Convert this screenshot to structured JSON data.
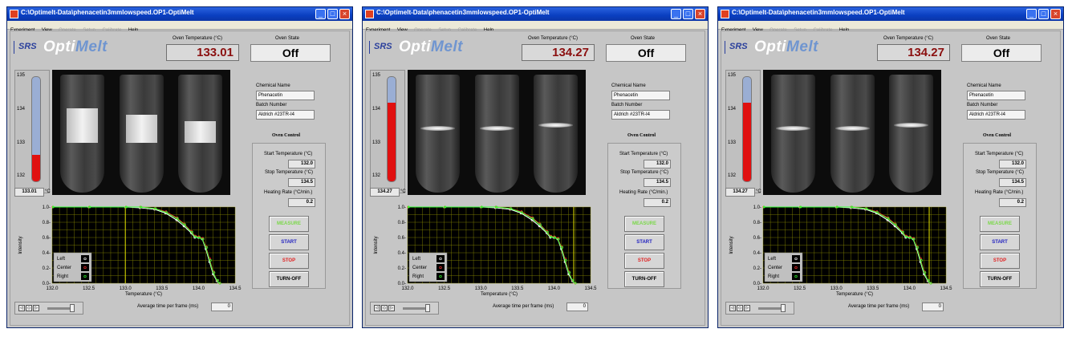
{
  "colors": {
    "titlebar": "#0a3fc0",
    "red_fill": "#e01010",
    "temp_text": "#8b1010",
    "plot_bg": "#000000",
    "grid": "#8f8f00",
    "vline": "#e6e600"
  },
  "windows": [
    {
      "title": "C:\\Optimelt-Data\\phenacetin3mmlowspeed.OP1-OptiMelt",
      "menu": [
        "Experiment",
        "View",
        "Operate",
        "Setup",
        "Calibrate",
        "Help"
      ],
      "logo": {
        "brand": "SRS",
        "opti": "Opti",
        "melt": "Melt"
      },
      "oven_temp_label": "Oven Temperature (°C)",
      "oven_temp": "133.01",
      "oven_state_label": "Oven State",
      "oven_state": "Off",
      "thermo_ticks": [
        "135",
        "134",
        "133",
        "132"
      ],
      "thermo_level": 0.252,
      "thermo_readout": "133.01",
      "thermo_unit": "°C",
      "frames": "powder",
      "chemical_name_label": "Chemical Name",
      "chemical_name": "Phenacetin",
      "batch_number_label": "Batch Number",
      "batch_number": "Aldrich #23TR-I4",
      "oven_control_title": "Oven Control",
      "start_temp_label": "Start Temperature (°C)",
      "start_temp": "132.0",
      "stop_temp_label": "Stop Temperature (°C)",
      "stop_temp": "134.5",
      "heating_rate_label": "Heating Rate (°C/min.)",
      "heating_rate": "0.2",
      "buttons": [
        "MEASURE",
        "START",
        "STOP",
        "TURN-OFF"
      ],
      "avg_label": "Average time per frame (ms)",
      "avg_value": "0",
      "legend": [
        "Left",
        "Center",
        "Right"
      ]
    },
    {
      "title": "C:\\Optimelt-Data\\phenacetin3mmlowspeed.OP1-OptiMelt",
      "menu": [
        "Experiment",
        "View",
        "Operate",
        "Setup",
        "Calibrate",
        "Help"
      ],
      "logo": {
        "brand": "SRS",
        "opti": "Opti",
        "melt": "Melt"
      },
      "oven_temp_label": "Oven Temperature (°C)",
      "oven_temp": "134.27",
      "oven_state_label": "Oven State",
      "oven_state": "Off",
      "thermo_ticks": [
        "135",
        "134",
        "133",
        "132"
      ],
      "thermo_level": 0.756,
      "thermo_readout": "134.27",
      "thermo_unit": "°C",
      "frames": "melted",
      "chemical_name_label": "Chemical Name",
      "chemical_name": "Phenacetin",
      "batch_number_label": "Batch Number",
      "batch_number": "Aldrich #23TR-I4",
      "oven_control_title": "Oven Control",
      "start_temp_label": "Start Temperature (°C)",
      "start_temp": "132.0",
      "stop_temp_label": "Stop Temperature (°C)",
      "stop_temp": "134.5",
      "heating_rate_label": "Heating Rate (°C/min.)",
      "heating_rate": "0.2",
      "buttons": [
        "MEASURE",
        "START",
        "STOP",
        "TURN-OFF"
      ],
      "avg_label": "Average time per frame (ms)",
      "avg_value": "0",
      "legend": [
        "Left",
        "Center",
        "Right"
      ]
    },
    {
      "title": "C:\\Optimelt-Data\\phenacetin3mmlowspeed.OP1-OptiMelt",
      "menu": [
        "Experiment",
        "View",
        "Operate",
        "Setup",
        "Calibrate",
        "Help"
      ],
      "logo": {
        "brand": "SRS",
        "opti": "Opti",
        "melt": "Melt"
      },
      "oven_temp_label": "Oven Temperature (°C)",
      "oven_temp": "134.27",
      "oven_state_label": "Oven State",
      "oven_state": "Off",
      "thermo_ticks": [
        "135",
        "134",
        "133",
        "132"
      ],
      "thermo_level": 0.756,
      "thermo_readout": "134.27",
      "thermo_unit": "°C",
      "frames": "melted",
      "chemical_name_label": "Chemical Name",
      "chemical_name": "Phenacetin",
      "batch_number_label": "Batch Number",
      "batch_number": "Aldrich #23TR-I4",
      "oven_control_title": "Oven Control",
      "start_temp_label": "Start Temperature (°C)",
      "start_temp": "132.0",
      "stop_temp_label": "Stop Temperature (°C)",
      "stop_temp": "134.5",
      "heating_rate_label": "Heating Rate (°C/min.)",
      "heating_rate": "0.2",
      "buttons": [
        "MEASURE",
        "START",
        "STOP",
        "TURN-OFF"
      ],
      "avg_label": "Average time per frame (ms)",
      "avg_value": "0",
      "legend": [
        "Left",
        "Center",
        "Right"
      ]
    }
  ],
  "chart_data": [
    {
      "type": "scatter",
      "xlabel": "Temperature (°C)",
      "ylabel": "Intensity",
      "xlim": [
        132.0,
        134.5
      ],
      "ylim": [
        0.0,
        1.0
      ],
      "xticks": [
        "132.0",
        "132.5",
        "133.0",
        "133.5",
        "134.0",
        "134.5"
      ],
      "yticks": [
        "0.0-",
        "0.2-",
        "0.4-",
        "0.6-",
        "0.8-",
        "1.0-"
      ],
      "cursor_x": 133.0,
      "grid": true,
      "legend_position": "bottom-left",
      "series": [
        {
          "name": "Left",
          "color": "#ffffff",
          "x": [
            132.0,
            132.5,
            133.0,
            133.2,
            133.4,
            133.55,
            133.7,
            133.8,
            133.9,
            133.95,
            134.0,
            134.05,
            134.1,
            134.15,
            134.2,
            134.25,
            134.28
          ],
          "y": [
            1.0,
            1.0,
            1.0,
            0.99,
            0.97,
            0.92,
            0.83,
            0.75,
            0.66,
            0.6,
            0.6,
            0.58,
            0.45,
            0.28,
            0.12,
            0.03,
            0.0
          ]
        },
        {
          "name": "Center",
          "color": "#ff3030",
          "x": [
            132.0,
            132.5,
            133.0,
            133.2,
            133.4,
            133.55,
            133.7,
            133.8,
            133.9,
            133.95,
            134.0,
            134.05,
            134.1,
            134.15,
            134.2,
            134.25,
            134.28
          ],
          "y": [
            1.0,
            1.0,
            1.0,
            1.0,
            0.98,
            0.94,
            0.86,
            0.78,
            0.68,
            0.62,
            0.61,
            0.59,
            0.48,
            0.32,
            0.15,
            0.04,
            0.0
          ]
        },
        {
          "name": "Right",
          "color": "#30ff30",
          "x": [
            132.0,
            132.5,
            133.0,
            133.2,
            133.4,
            133.55,
            133.7,
            133.8,
            133.9,
            133.95,
            134.0,
            134.05,
            134.1,
            134.15,
            134.2,
            134.25,
            134.28
          ],
          "y": [
            1.0,
            1.0,
            1.0,
            1.0,
            0.98,
            0.93,
            0.85,
            0.77,
            0.67,
            0.61,
            0.6,
            0.58,
            0.47,
            0.3,
            0.14,
            0.04,
            0.0
          ]
        }
      ]
    },
    {
      "type": "scatter",
      "xlabel": "Temperature (°C)",
      "ylabel": "Intensity",
      "xlim": [
        132.0,
        134.5
      ],
      "ylim": [
        0.0,
        1.0
      ],
      "xticks": [
        "132.0",
        "132.5",
        "133.0",
        "133.5",
        "134.0",
        "134.5"
      ],
      "yticks": [
        "0.0-",
        "0.2-",
        "0.4-",
        "0.6-",
        "0.8-",
        "1.0-"
      ],
      "cursor_x": 134.27,
      "grid": true,
      "legend_position": "bottom-left",
      "series": [
        {
          "name": "Left",
          "color": "#ffffff",
          "x": [
            132.0,
            132.5,
            133.0,
            133.2,
            133.4,
            133.55,
            133.7,
            133.8,
            133.9,
            133.95,
            134.0,
            134.05,
            134.1,
            134.15,
            134.2,
            134.25,
            134.28
          ],
          "y": [
            1.0,
            1.0,
            1.0,
            0.99,
            0.97,
            0.92,
            0.83,
            0.75,
            0.66,
            0.6,
            0.6,
            0.58,
            0.45,
            0.28,
            0.12,
            0.03,
            0.0
          ]
        },
        {
          "name": "Center",
          "color": "#ff3030",
          "x": [
            132.0,
            132.5,
            133.0,
            133.2,
            133.4,
            133.55,
            133.7,
            133.8,
            133.9,
            133.95,
            134.0,
            134.05,
            134.1,
            134.15,
            134.2,
            134.25,
            134.28
          ],
          "y": [
            1.0,
            1.0,
            1.0,
            1.0,
            0.98,
            0.94,
            0.86,
            0.78,
            0.68,
            0.62,
            0.61,
            0.59,
            0.48,
            0.32,
            0.15,
            0.04,
            0.0
          ]
        },
        {
          "name": "Right",
          "color": "#30ff30",
          "x": [
            132.0,
            132.5,
            133.0,
            133.2,
            133.4,
            133.55,
            133.7,
            133.8,
            133.9,
            133.95,
            134.0,
            134.05,
            134.1,
            134.15,
            134.2,
            134.25,
            134.28
          ],
          "y": [
            1.0,
            1.0,
            1.0,
            1.0,
            0.98,
            0.93,
            0.85,
            0.77,
            0.67,
            0.61,
            0.6,
            0.58,
            0.47,
            0.3,
            0.14,
            0.04,
            0.0
          ]
        }
      ]
    },
    {
      "type": "scatter",
      "xlabel": "Temperature (°C)",
      "ylabel": "Intensity",
      "xlim": [
        132.0,
        134.5
      ],
      "ylim": [
        0.0,
        1.0
      ],
      "xticks": [
        "132.0",
        "132.5",
        "133.0",
        "133.5",
        "134.0",
        "134.5"
      ],
      "yticks": [
        "0.0-",
        "0.2-",
        "0.4-",
        "0.6-",
        "0.8-",
        "1.0-"
      ],
      "cursor_x": 134.27,
      "grid": true,
      "legend_position": "bottom-left",
      "series": [
        {
          "name": "Left",
          "color": "#ffffff",
          "x": [
            132.0,
            132.5,
            133.0,
            133.2,
            133.4,
            133.55,
            133.7,
            133.8,
            133.9,
            133.95,
            134.0,
            134.05,
            134.1,
            134.15,
            134.2,
            134.25,
            134.28
          ],
          "y": [
            1.0,
            1.0,
            1.0,
            0.99,
            0.97,
            0.92,
            0.83,
            0.75,
            0.66,
            0.6,
            0.6,
            0.58,
            0.45,
            0.28,
            0.12,
            0.03,
            0.0
          ]
        },
        {
          "name": "Center",
          "color": "#ff3030",
          "x": [
            132.0,
            132.5,
            133.0,
            133.2,
            133.4,
            133.55,
            133.7,
            133.8,
            133.9,
            133.95,
            134.0,
            134.05,
            134.1,
            134.15,
            134.2,
            134.25,
            134.28
          ],
          "y": [
            1.0,
            1.0,
            1.0,
            1.0,
            0.98,
            0.94,
            0.86,
            0.78,
            0.68,
            0.62,
            0.61,
            0.59,
            0.48,
            0.32,
            0.15,
            0.04,
            0.0
          ]
        },
        {
          "name": "Right",
          "color": "#30ff30",
          "x": [
            132.0,
            132.5,
            133.0,
            133.2,
            133.4,
            133.55,
            133.7,
            133.8,
            133.9,
            133.95,
            134.0,
            134.05,
            134.1,
            134.15,
            134.2,
            134.25,
            134.28
          ],
          "y": [
            1.0,
            1.0,
            1.0,
            1.0,
            0.98,
            0.93,
            0.85,
            0.77,
            0.67,
            0.61,
            0.6,
            0.58,
            0.47,
            0.3,
            0.14,
            0.04,
            0.0
          ]
        }
      ]
    }
  ]
}
